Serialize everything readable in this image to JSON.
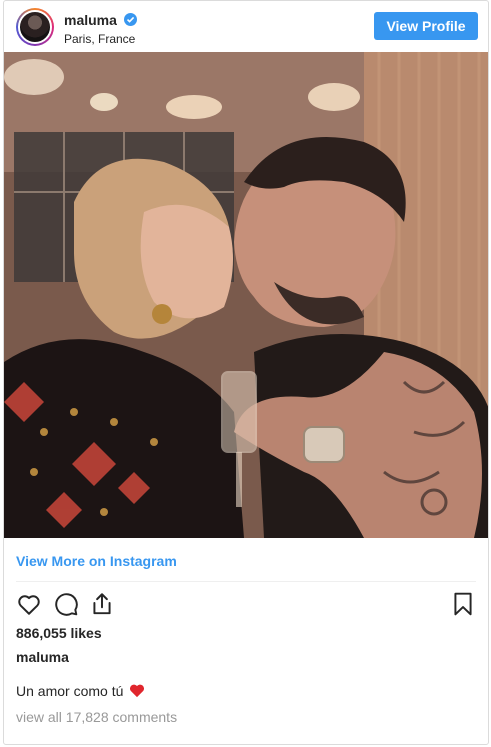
{
  "header": {
    "username": "maluma",
    "location": "Paris, France",
    "view_profile_label": "View Profile"
  },
  "view_more_label": "View More on Instagram",
  "actions": {
    "icons": [
      "heart-icon",
      "comment-icon",
      "share-icon",
      "bookmark-icon"
    ]
  },
  "likes_text": "886,055 likes",
  "owner_name": "maluma",
  "caption_text": "Un amor como tú",
  "caption_emoji": "red-heart",
  "comments_text": "view all 17,828 comments",
  "colors": {
    "accent": "#3897f0",
    "text": "#262626",
    "muted": "#999999",
    "border": "#dbdbdb"
  }
}
